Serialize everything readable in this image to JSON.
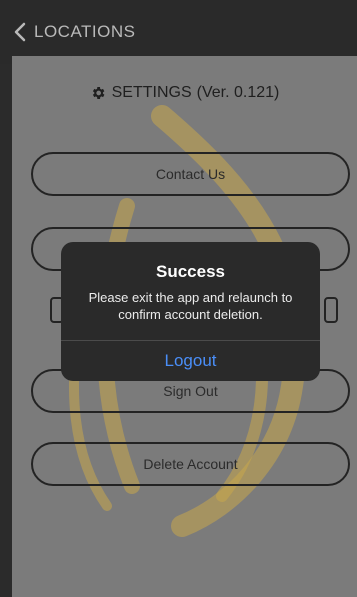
{
  "header": {
    "back_label": "LOCATIONS",
    "icon": "chevron-left-icon"
  },
  "settings": {
    "title": "SETTINGS",
    "version": "(Ver. 0.121)",
    "icon": "gear-icon"
  },
  "buttons": {
    "contact": "Contact Us",
    "sign_out": "Sign Out",
    "delete_account": "Delete Account"
  },
  "dialog": {
    "title": "Success",
    "message": "Please exit the app and relaunch to confirm account deletion.",
    "button": "Logout"
  },
  "colors": {
    "header_bg": "#2a2a2a",
    "dialog_bg": "#2a2a2a",
    "accent": "#4a8ef7",
    "flame": "#c9a84c"
  }
}
